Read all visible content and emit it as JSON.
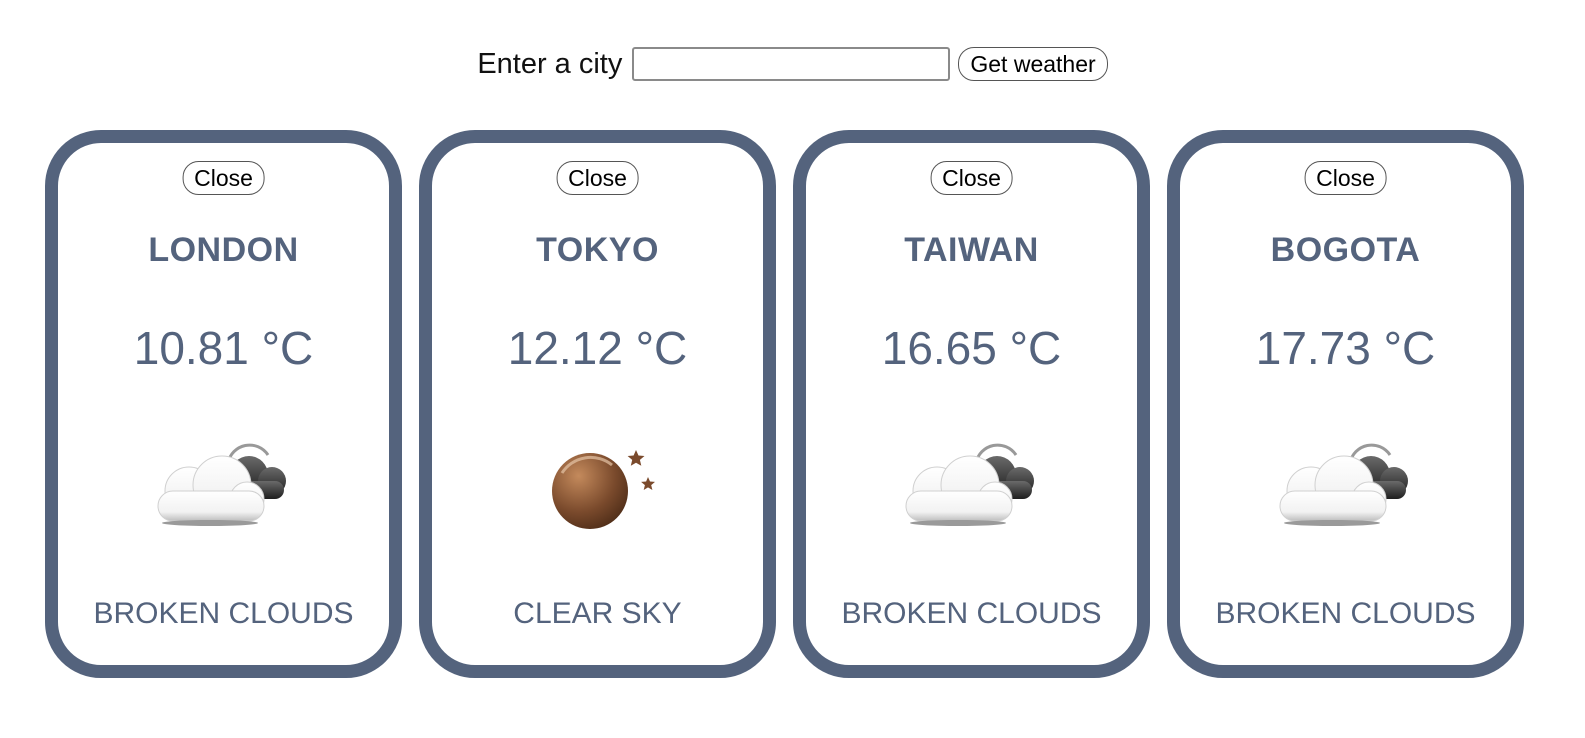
{
  "search": {
    "label": "Enter a city",
    "value": "",
    "placeholder": "",
    "button_label": "Get weather"
  },
  "cards": [
    {
      "close_label": "Close",
      "city": "LONDON",
      "temp": "10.81 °C",
      "icon": "broken-clouds-icon",
      "description": "BROKEN CLOUDS"
    },
    {
      "close_label": "Close",
      "city": "TOKYO",
      "temp": "12.12 °C",
      "icon": "clear-sky-night-icon",
      "description": "CLEAR SKY"
    },
    {
      "close_label": "Close",
      "city": "TAIWAN",
      "temp": "16.65 °C",
      "icon": "broken-clouds-icon",
      "description": "BROKEN CLOUDS"
    },
    {
      "close_label": "Close",
      "city": "BOGOTA",
      "temp": "17.73 °C",
      "icon": "broken-clouds-icon",
      "description": "BROKEN CLOUDS"
    }
  ],
  "colors": {
    "card_accent": "#54637d"
  }
}
